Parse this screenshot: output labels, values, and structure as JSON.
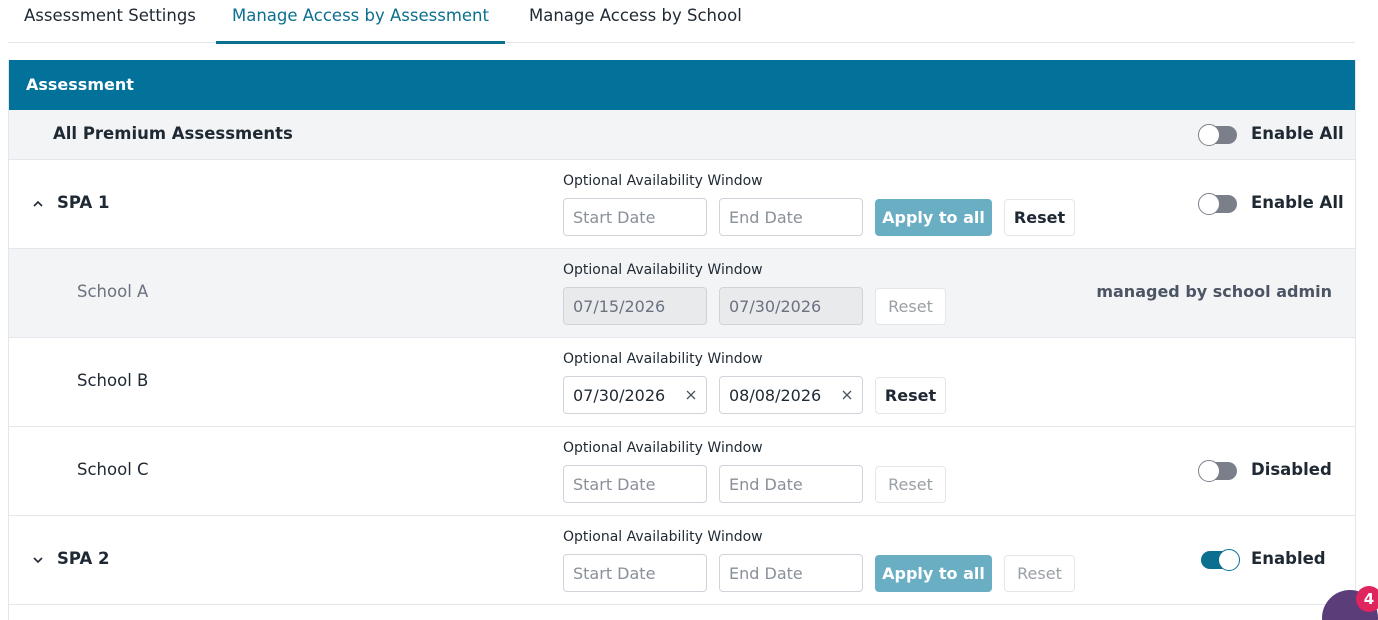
{
  "tabs": [
    {
      "label": "Assessment Settings"
    },
    {
      "label": "Manage Access by Assessment"
    },
    {
      "label": "Manage Access by School"
    }
  ],
  "active_tab": "Manage Access by Assessment",
  "table": {
    "header": "Assessment",
    "all_row": {
      "label": "All Premium Assessments",
      "toggle_label": "Enable All",
      "toggle_on": false
    },
    "window_title": "Optional Availability Window",
    "start_placeholder": "Start Date",
    "end_placeholder": "End Date",
    "apply_label": "Apply to all",
    "reset_label": "Reset",
    "rows": [
      {
        "label": "SPA 1",
        "expanded": true,
        "toggle_label": "Enable All",
        "toggle_on": false
      },
      {
        "label": "School A",
        "start": "07/15/2026",
        "end": "07/30/2026",
        "status": "managed by school admin"
      },
      {
        "label": "School B",
        "start": "07/30/2026",
        "end": "08/08/2026"
      },
      {
        "label": "School C",
        "toggle_label": "Disabled",
        "toggle_on": false
      },
      {
        "label": "SPA 2",
        "expanded": false,
        "toggle_label": "Enabled",
        "toggle_on": true
      }
    ]
  },
  "chat": {
    "badge_count": "4"
  },
  "colors": {
    "accent": "#0b6f8f",
    "header_bg": "#03729a",
    "apply_bg": "#6aaec4",
    "row_gray": "#f3f4f6"
  }
}
